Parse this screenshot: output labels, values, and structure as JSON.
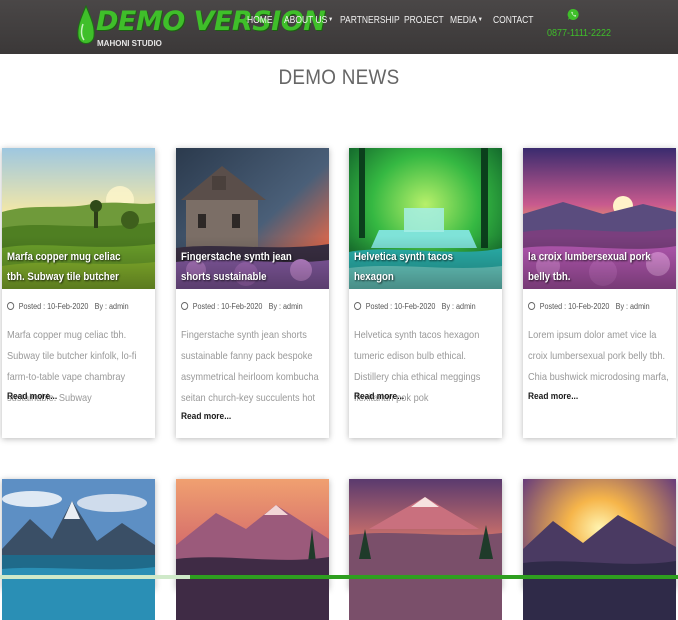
{
  "header": {
    "logo_title": "DEMO VERSION",
    "logo_subtitle": "MAHONI STUDIO",
    "phone": "0877-1111-2222",
    "phone_icon": "whatsapp-icon",
    "accent_color": "#3fbf2a"
  },
  "nav": {
    "items": [
      {
        "label": "HOME",
        "has_dropdown": false
      },
      {
        "label": "ABOUT US",
        "has_dropdown": true
      },
      {
        "label": "PARTNERSHIP",
        "has_dropdown": false
      },
      {
        "label": "PROJECT",
        "has_dropdown": false
      },
      {
        "label": "MEDIA",
        "has_dropdown": true
      },
      {
        "label": "CONTACT",
        "has_dropdown": false
      }
    ]
  },
  "section": {
    "title": "DEMO NEWS"
  },
  "posts": [
    {
      "title": "Marfa copper mug celiac tbh. Subway tile butcher kinfolk",
      "posted": "Posted : 10-Feb-2020",
      "author": "By : admin",
      "excerpt": "Marfa copper mug celiac tbh. Subway tile butcher kinfolk, lo-fi farm-to-table vape chambray sustainable. Subway",
      "read_more": "Read more..."
    },
    {
      "title": "Fingerstache synth jean shorts sustainable",
      "posted": "Posted : 10-Feb-2020",
      "author": "By : admin",
      "excerpt": "Fingerstache synth jean shorts sustainable fanny pack bespoke asymmetrical heirloom kombucha seitan church-key succulents hot",
      "read_more": "Read more..."
    },
    {
      "title": "Helvetica synth tacos hexagon",
      "posted": "Posted : 10-Feb-2020",
      "author": "By : admin",
      "excerpt": "Helvetica synth tacos hexagon tumeric edison bulb ethical. Distillery chia ethical meggings flexitarian pok pok",
      "read_more": "Read more..."
    },
    {
      "title": "la croix lumbersexual pork belly tbh.",
      "posted": "Posted : 10-Feb-2020",
      "author": "By : admin",
      "excerpt": "Lorem ipsum dolor amet vice la croix lumbersexual pork belly tbh. Chia bushwick microdosing marfa,",
      "read_more": "Read more..."
    }
  ]
}
